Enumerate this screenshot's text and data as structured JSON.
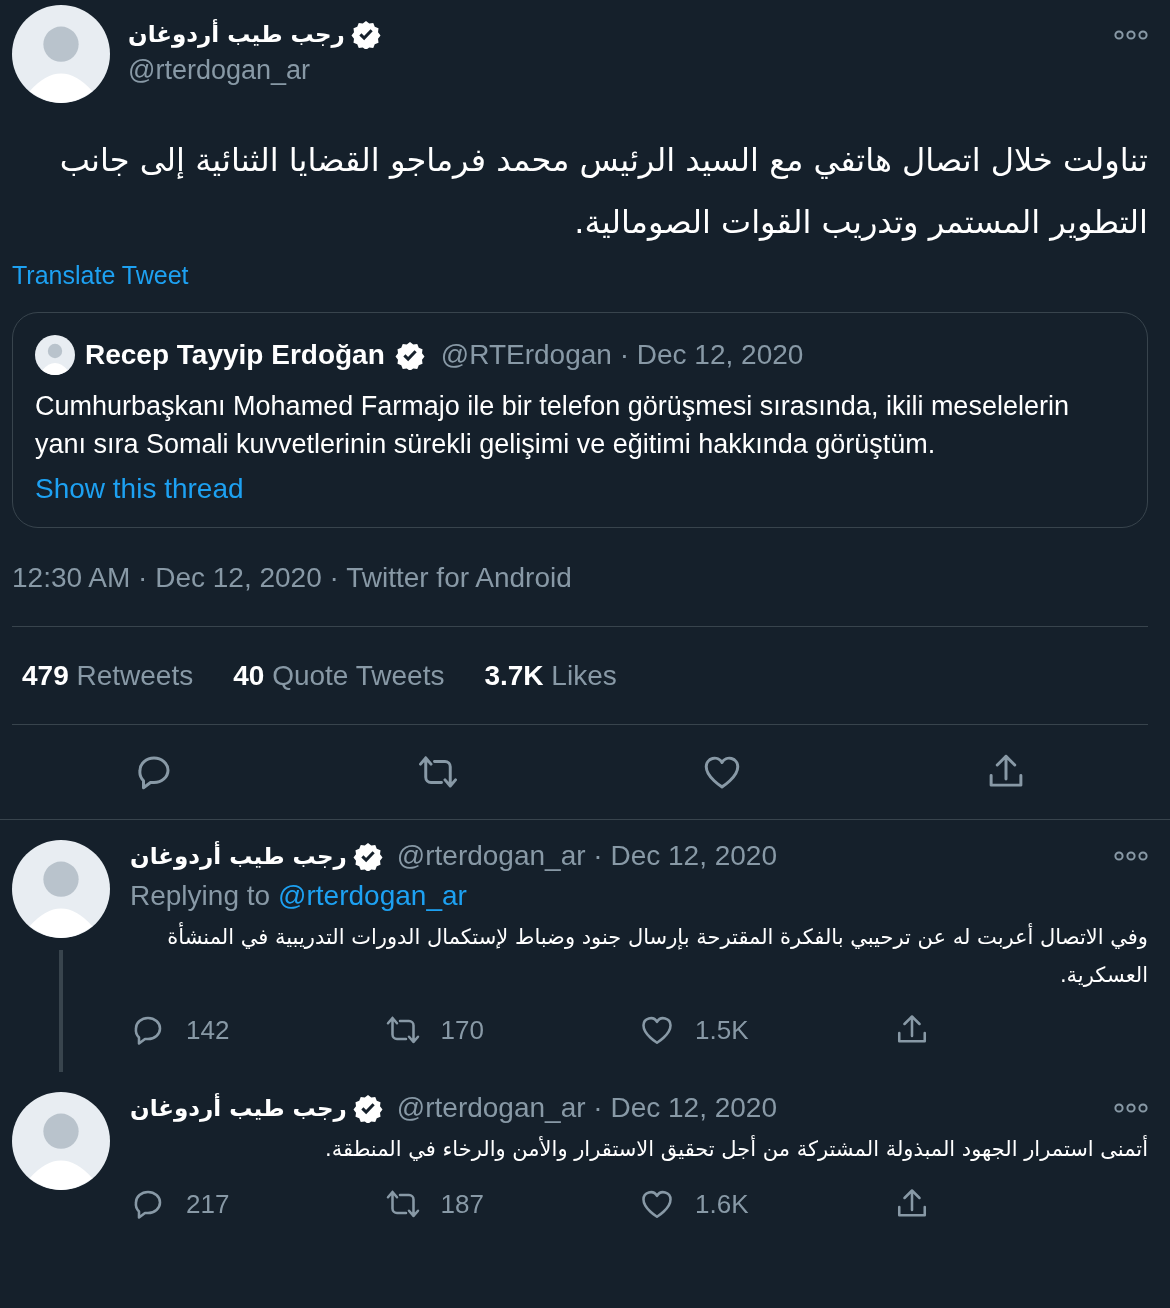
{
  "main_tweet": {
    "author": {
      "name": "رجب طيب أردوغان",
      "verified": true,
      "handle": "@rterdogan_ar"
    },
    "text": "تناولت خلال اتصال هاتفي مع السيد الرئيس محمد فرماجو القضايا الثنائية إلى جانب التطوير المستمر وتدريب القوات الصومالية.",
    "translate": "Translate Tweet",
    "quoted": {
      "name": "Recep Tayyip Erdoğan",
      "verified": true,
      "handle_date": "@RTErdogan · Dec 12, 2020",
      "text": "Cumhurbaşkanı Mohamed Farmajo ile bir telefon görüşmesi sırasında, ikili meselelerin yanı sıra Somali kuvvetlerinin sürekli gelişimi ve eğitimi hakkında görüştüm.",
      "show_thread": "Show this thread"
    },
    "meta": "12:30 AM · Dec 12, 2020 · Twitter for Android",
    "stats": [
      "**479** Retweets",
      "**40** Quote Tweets",
      "**3.7K** Likes"
    ]
  },
  "replies": [
    {
      "name": "رجب طيب أردوغان",
      "verified": true,
      "handle_date": "@rterdogan_ar · Dec 12, 2020",
      "replying_label": "Replying to",
      "replying_to": "@rterdogan_ar",
      "text": "وفي الاتصال أعربت له عن ترحيبي بالفكرة المقترحة بإرسال جنود وضباط لإستكمال الدورات التدريبية في المنشأة العسكرية.",
      "thread_line": true,
      "replies": "142",
      "retweets": "170",
      "likes": "1.5K"
    },
    {
      "name": "رجب طيب أردوغان",
      "verified": true,
      "handle_date": "@rterdogan_ar · Dec 12, 2020",
      "text": "أتمنى استمرار الجهود المبذولة المشتركة من أجل تحقيق الاستقرار والأمن والرخاء في المنطقة.",
      "thread_line": false,
      "replies": "217",
      "retweets": "187",
      "likes": "1.6K"
    }
  ]
}
